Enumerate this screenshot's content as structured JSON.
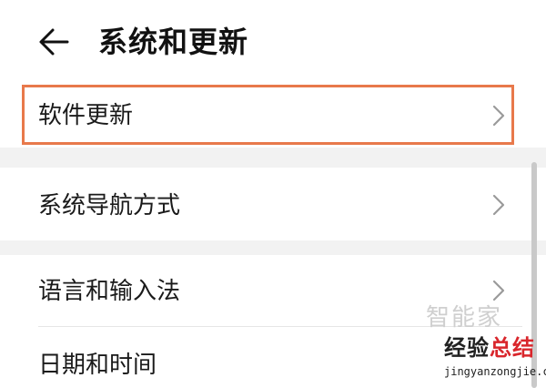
{
  "header": {
    "title": "系统和更新"
  },
  "settings": {
    "items": [
      {
        "label": "软件更新",
        "highlighted": true
      },
      {
        "label": "系统导航方式"
      },
      {
        "label": "语言和输入法"
      },
      {
        "label": "日期和时间"
      }
    ]
  },
  "watermark": {
    "logo_text": "智能家",
    "main_text_black": "经验",
    "main_text_red": "总结",
    "url": "jingyanzongjie.com"
  },
  "colors": {
    "highlight_border": "#e8794b",
    "section_gap": "#f2f2f2",
    "chevron": "#9a9a9a"
  }
}
